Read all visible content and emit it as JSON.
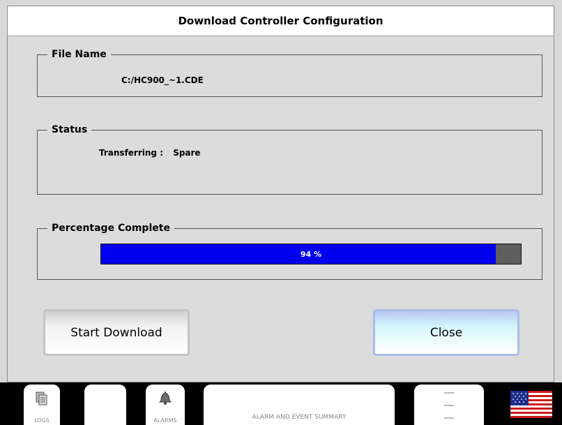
{
  "dialog": {
    "title": "Download Controller Configuration",
    "file_group": {
      "legend": "File Name",
      "value": "C:/HC900_~1.CDE"
    },
    "status_group": {
      "legend": "Status",
      "label": "Transferring :",
      "value": "Spare"
    },
    "progress_group": {
      "legend": "Percentage Complete",
      "percent": 94,
      "text": "94 %"
    },
    "buttons": {
      "start": "Start Download",
      "close": "Close"
    }
  },
  "taskbar": {
    "logs_label": "LOGS",
    "alarms_label": "ALARMS",
    "summary_label": "ALARM AND EVENT SUMMARY"
  },
  "colors": {
    "progress_fill": "#0000ee",
    "progress_track": "#5e5e5e",
    "close_button": "#d4f7fb"
  },
  "icons": {
    "logs": "logs-icon",
    "alarms": "bell-icon",
    "menu": "menu-lines-icon",
    "language": "us-flag-icon"
  }
}
